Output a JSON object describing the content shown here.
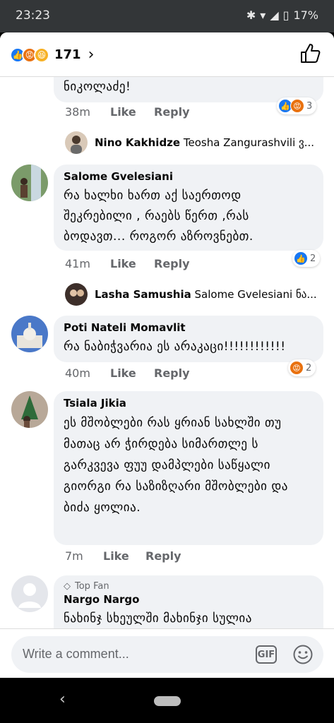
{
  "status": {
    "time": "23:23",
    "battery": "17%"
  },
  "header": {
    "reaction_count": "171"
  },
  "comments": [
    {
      "text": "ნიკოლაძე!",
      "time": "38m",
      "like": "Like",
      "reply": "Reply",
      "reaction_count": "3",
      "reply_preview": {
        "author": "Nino Kakhidze",
        "text": "Teosha Zangurashvili ვ..."
      }
    },
    {
      "author": "Salome  Gvelesiani",
      "text": "რა ხალხი ხართ აქ საერთოდ შეკრებილი , რაებს წერთ ,რას ბოდავთ... როგორ აზროვნებთ.",
      "time": "41m",
      "like": "Like",
      "reply": "Reply",
      "reaction_count": "2",
      "reply_preview": {
        "author": "Lasha Samushia",
        "text": "Salome  Gvelesiani ნა..."
      }
    },
    {
      "author": "Poti Nateli Momavlit",
      "text": "რა ნაბიჭვარია ეს არაკაცი!!!!!!!!!!!!",
      "time": "40m",
      "like": "Like",
      "reply": "Reply",
      "reaction_count": "2"
    },
    {
      "author": "Tsiala Jikia",
      "text": "ეს მშობლები რას ყრიან სახლში თუ მათაც არ  ჭირდება სიმართლე ს გარკვევა ფუუ დამპლები საწყალი გიორგი რა საზიზღარი მშობლები და ბიძა ყოლია.",
      "time": "7m",
      "like": "Like",
      "reply": "Reply"
    },
    {
      "badge": "Top Fan",
      "author": "Nargo Nargo",
      "text": "ნახინჯ სხეულში მახინჯი სულია"
    }
  ],
  "composer": {
    "placeholder": "Write a comment...",
    "gif": "GIF"
  }
}
